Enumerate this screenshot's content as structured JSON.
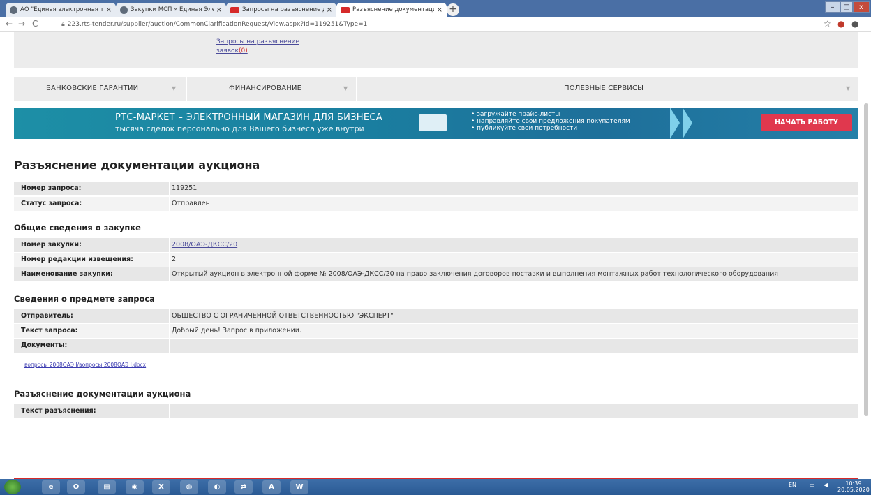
{
  "browser": {
    "tabs": [
      {
        "label": "АО \"Единая электронная торгов",
        "favicon": "globe-icon"
      },
      {
        "label": "Закупки МСП » Единая Электро",
        "favicon": "globe-icon"
      },
      {
        "label": "Запросы на разъяснение доку",
        "favicon": "rtc-icon"
      },
      {
        "label": "Разъяснение документации аук",
        "favicon": "rtc-icon"
      }
    ],
    "tab_close": "×",
    "new_tab": "+",
    "url": "223.rts-tender.ru/supplier/auction/CommonClarificationRequest/View.aspx?Id=119251&Type=1",
    "back": "←",
    "forward": "→",
    "reload": "C",
    "star": "☆",
    "account": "●"
  },
  "top_links": {
    "clarification_requests_line1": "Запросы на разъяснение",
    "clarification_requests_line2": "заявок",
    "clarification_requests_count": "(0)"
  },
  "menu": {
    "items": [
      {
        "label": "БАНКОВСКИЕ ГАРАНТИИ"
      },
      {
        "label": "ФИНАНСИРОВАНИЕ"
      },
      {
        "label": "ПОЛЕЗНЫЕ СЕРВИСЫ"
      }
    ],
    "caret": "▼"
  },
  "banner": {
    "title": "РТС-МАРКЕТ – ЭЛЕКТРОННЫЙ МАГАЗИН ДЛЯ БИЗНЕСА",
    "subtitle": "тысяча сделок персонально для Вашего бизнеса уже внутри",
    "bullets": [
      "• загружайте прайс-листы",
      "• направляйте свои предложения покупателям",
      "• публикуйте свои потребности"
    ],
    "button": "НАЧАТЬ РАБОТУ",
    "button_color": "#e0384e"
  },
  "page": {
    "title": "Разъяснение документации аукциона",
    "request": {
      "number_label": "Номер запроса:",
      "number_value": "119251",
      "status_label": "Статус запроса:",
      "status_value": "Отправлен"
    },
    "purchase_section": {
      "heading": "Общие сведения о закупке",
      "number_label": "Номер закупки:",
      "number_value": "2008/ОАЭ-ДКСС/20",
      "revision_label": "Номер редакции извещения:",
      "revision_value": "2",
      "name_label": "Наименование закупки:",
      "name_value": "Открытый аукцион в электронной форме № 2008/ОАЭ-ДКСС/20 на право заключения договоров поставки и выполнения монтажных работ технологического оборудования"
    },
    "subject_section": {
      "heading": "Сведения о предмете запроса",
      "sender_label": "Отправитель:",
      "sender_value": "ОБЩЕСТВО С ОГРАНИЧЕННОЙ ОТВЕТСТВЕННОСТЬЮ \"ЭКСПЕРТ\"",
      "text_label": "Текст запроса:",
      "text_value": "Добрый день! Запрос в приложении.",
      "docs_label": "Документы:",
      "doc_link": "вопросы 2008ОАЭ I/вопросы 2008ОАЭ I.docx"
    },
    "clarification_section": {
      "heading": "Разъяснение документации аукциона",
      "text_label": "Текст разъяснения:"
    }
  },
  "taskbar": {
    "apps": [
      "e",
      "O",
      "▤",
      "◉",
      "X",
      "◍",
      "◐",
      "⇄",
      "A",
      "W"
    ],
    "lang": "EN",
    "time": "10:39",
    "date": "20.05.2020"
  },
  "colors": {
    "accent_red": "#d62a2a",
    "link": "#4b4b9a",
    "banner_teal": "#1a7fa0"
  }
}
